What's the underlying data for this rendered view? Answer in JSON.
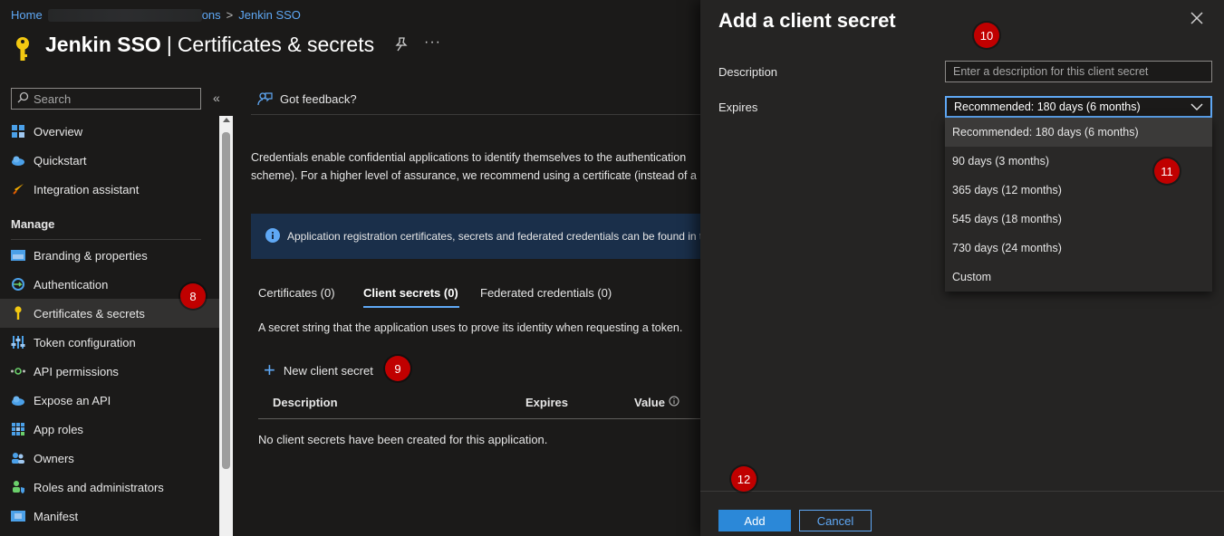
{
  "breadcrumb": {
    "home": "Home",
    "parent_visible_fragment": "ons",
    "current": "Jenkin SSO"
  },
  "page": {
    "app_name": "Jenkin SSO",
    "separator": "|",
    "section": "Certificates & secrets",
    "more": "···"
  },
  "sidebar": {
    "search_placeholder": "Search",
    "collapse_glyph": "«",
    "top_items": [
      {
        "label": "Overview",
        "icon": "grid-icon"
      },
      {
        "label": "Quickstart",
        "icon": "cloud-icon"
      },
      {
        "label": "Integration assistant",
        "icon": "rocket-icon"
      }
    ],
    "section_title": "Manage",
    "items": [
      {
        "label": "Branding & properties",
        "icon": "branding-icon"
      },
      {
        "label": "Authentication",
        "icon": "auth-icon"
      },
      {
        "label": "Certificates & secrets",
        "icon": "key-icon",
        "active": true
      },
      {
        "label": "Token configuration",
        "icon": "sliders-icon"
      },
      {
        "label": "API permissions",
        "icon": "api-icon"
      },
      {
        "label": "Expose an API",
        "icon": "cloud-icon"
      },
      {
        "label": "App roles",
        "icon": "grid-icon"
      },
      {
        "label": "Owners",
        "icon": "people-icon"
      },
      {
        "label": "Roles and administrators",
        "icon": "user-shield-icon"
      },
      {
        "label": "Manifest",
        "icon": "manifest-icon"
      }
    ]
  },
  "main": {
    "feedback": "Got feedback?",
    "description_line1": "Credentials enable confidential applications to identify themselves to the authentication",
    "description_line2": "scheme). For a higher level of assurance, we recommend using a certificate (instead of a",
    "info_text": "Application registration certificates, secrets and federated credentials can be found in the",
    "tabs": [
      {
        "label": "Certificates (0)"
      },
      {
        "label": "Client secrets (0)",
        "active": true
      },
      {
        "label": "Federated credentials (0)"
      }
    ],
    "secret_description": "A secret string that the application uses to prove its identity when requesting a token.",
    "new_secret_label": "New client secret",
    "table_headers": {
      "description": "Description",
      "expires": "Expires",
      "value": "Value"
    },
    "empty_message": "No client secrets have been created for this application."
  },
  "panel": {
    "title": "Add a client secret",
    "description_label": "Description",
    "description_placeholder": "Enter a description for this client secret",
    "expires_label": "Expires",
    "expires_selected": "Recommended: 180 days (6 months)",
    "options": [
      "Recommended: 180 days (6 months)",
      "90 days (3 months)",
      "365 days (12 months)",
      "545 days (18 months)",
      "730 days (24 months)",
      "Custom"
    ],
    "add_label": "Add",
    "cancel_label": "Cancel"
  },
  "badges": {
    "b8": "8",
    "b9": "9",
    "b10": "10",
    "b11": "11",
    "b12": "12"
  },
  "colors": {
    "accent": "#5fa8f5",
    "badge": "#c00000",
    "primary_button": "#2b88d8",
    "info_bar": "#1a2f4a"
  }
}
